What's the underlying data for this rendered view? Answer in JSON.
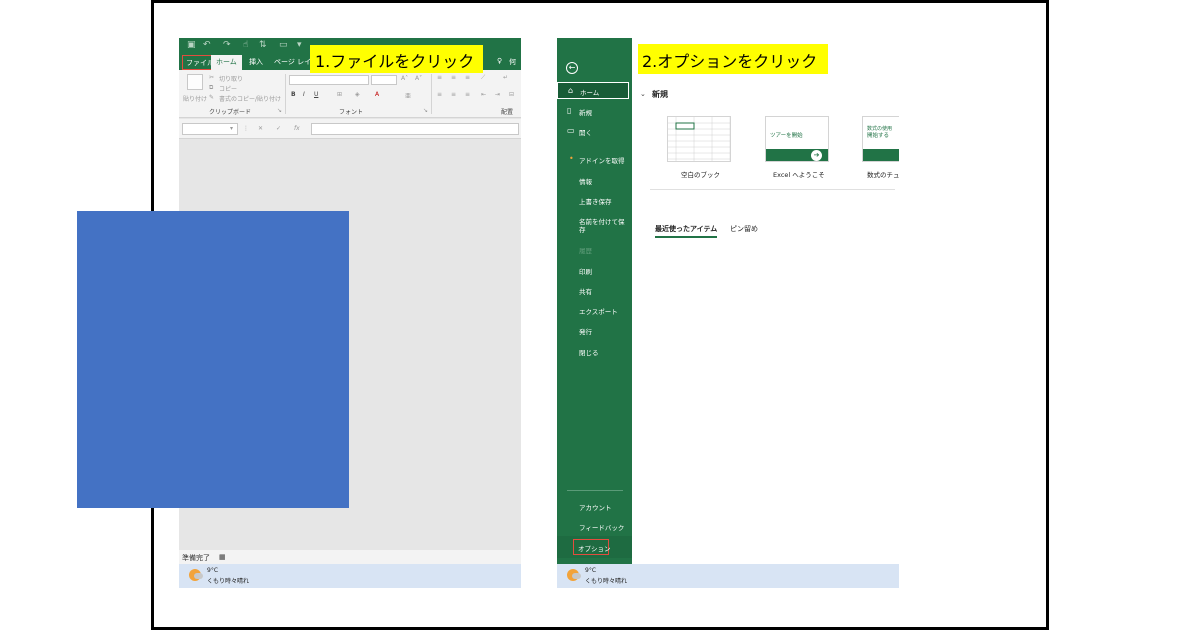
{
  "callouts": {
    "step1": "1.ファイルをクリック",
    "step2": "2.オプションをクリック"
  },
  "left": {
    "tabs": [
      "ファイル",
      "ホーム",
      "挿入",
      "ページ レイアウ"
    ],
    "tell_me": "何",
    "ribbon": {
      "paste": "貼り付け",
      "cut": "切り取り",
      "copy": "コピー",
      "format_painter": "書式のコピー/貼り付け",
      "clipboard_group": "クリップボード",
      "font_group": "フォント",
      "align_group": "配置",
      "bold": "B",
      "italic": "I",
      "underline": "U",
      "font_grow": "A˄",
      "font_shrink": "A˅",
      "font_color": "A"
    },
    "formula_fx": "fx",
    "status": "準備完了"
  },
  "taskbar": {
    "temp": "9°C",
    "weather": "くもり時々晴れ"
  },
  "right": {
    "nav": {
      "home": "ホーム",
      "new": "新規",
      "open": "開く",
      "get_addins": "アドインを取得",
      "info": "情報",
      "save": "上書き保存",
      "save_as_1": "名前を付けて保",
      "save_as_2": "存",
      "history": "履歴",
      "print": "印刷",
      "share": "共有",
      "export": "エクスポート",
      "publish": "発行",
      "close": "閉じる",
      "account": "アカウント",
      "feedback": "フィードバック",
      "options": "オプション"
    },
    "new_section": "新規",
    "templates": [
      {
        "label": "空白のブック"
      },
      {
        "label": "Excel へようこそ",
        "tile_text": "ツアーを開始"
      },
      {
        "label": "数式のチュー",
        "tile_text_1": "数式の使用",
        "tile_text_2": "開始する"
      }
    ],
    "recent_tab": "最近使ったアイテム",
    "pinned_tab": "ピン留め"
  },
  "colors": {
    "excel_green": "#217346",
    "callout_yellow": "#ffff00",
    "highlight_red": "#e24d3e",
    "redact_blue": "#4472c4"
  }
}
